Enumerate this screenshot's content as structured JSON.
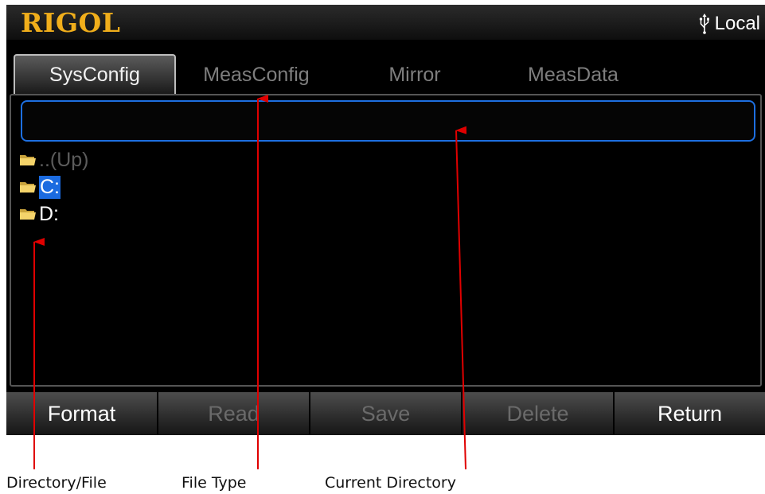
{
  "header": {
    "logo": "RIGOL",
    "status_icon": "usb-icon",
    "status_label": "Local"
  },
  "tabs": [
    {
      "label": "SysConfig",
      "active": true
    },
    {
      "label": "MeasConfig",
      "active": false
    },
    {
      "label": "Mirror",
      "active": false
    },
    {
      "label": "MeasData",
      "active": false
    }
  ],
  "current_directory": {
    "value": ""
  },
  "files": [
    {
      "label": "..(Up)",
      "icon": "folder-icon",
      "state": "disabled"
    },
    {
      "label": "C:",
      "icon": "folder-icon",
      "state": "selected"
    },
    {
      "label": "D:",
      "icon": "folder-icon",
      "state": "normal"
    }
  ],
  "softkeys": [
    {
      "label": "Format",
      "enabled": true
    },
    {
      "label": "Read",
      "enabled": false
    },
    {
      "label": "Save",
      "enabled": false
    },
    {
      "label": "Delete",
      "enabled": false
    },
    {
      "label": "Return",
      "enabled": true
    }
  ],
  "annotations": {
    "directory_file": "Directory/File",
    "file_type": "File Type",
    "current_directory": "Current Directory"
  },
  "colors": {
    "logo": "#f0ae1b",
    "selection": "#1b6be0",
    "directory_border": "#1d6fe0",
    "folder": "#f4d36a",
    "arrow": "#e00000"
  }
}
